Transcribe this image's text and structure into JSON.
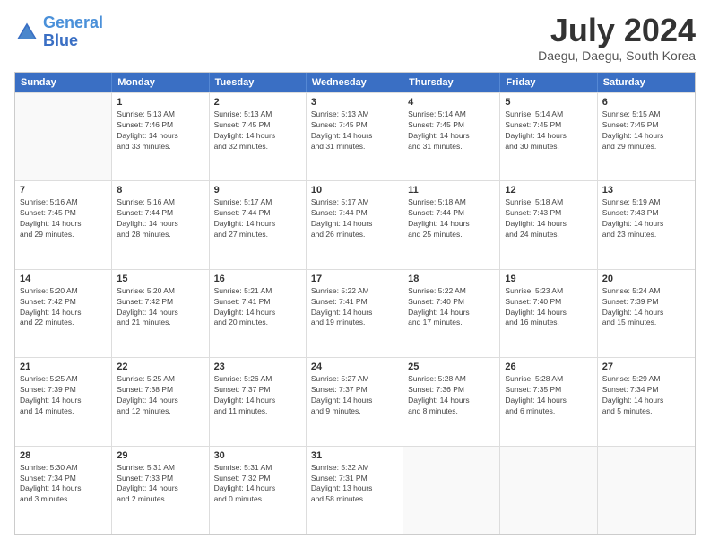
{
  "logo": {
    "line1": "General",
    "line2": "Blue"
  },
  "title": "July 2024",
  "subtitle": "Daegu, Daegu, South Korea",
  "headers": [
    "Sunday",
    "Monday",
    "Tuesday",
    "Wednesday",
    "Thursday",
    "Friday",
    "Saturday"
  ],
  "weeks": [
    [
      {
        "day": "",
        "info": ""
      },
      {
        "day": "1",
        "info": "Sunrise: 5:13 AM\nSunset: 7:46 PM\nDaylight: 14 hours\nand 33 minutes."
      },
      {
        "day": "2",
        "info": "Sunrise: 5:13 AM\nSunset: 7:45 PM\nDaylight: 14 hours\nand 32 minutes."
      },
      {
        "day": "3",
        "info": "Sunrise: 5:13 AM\nSunset: 7:45 PM\nDaylight: 14 hours\nand 31 minutes."
      },
      {
        "day": "4",
        "info": "Sunrise: 5:14 AM\nSunset: 7:45 PM\nDaylight: 14 hours\nand 31 minutes."
      },
      {
        "day": "5",
        "info": "Sunrise: 5:14 AM\nSunset: 7:45 PM\nDaylight: 14 hours\nand 30 minutes."
      },
      {
        "day": "6",
        "info": "Sunrise: 5:15 AM\nSunset: 7:45 PM\nDaylight: 14 hours\nand 29 minutes."
      }
    ],
    [
      {
        "day": "7",
        "info": "Sunrise: 5:16 AM\nSunset: 7:45 PM\nDaylight: 14 hours\nand 29 minutes."
      },
      {
        "day": "8",
        "info": "Sunrise: 5:16 AM\nSunset: 7:44 PM\nDaylight: 14 hours\nand 28 minutes."
      },
      {
        "day": "9",
        "info": "Sunrise: 5:17 AM\nSunset: 7:44 PM\nDaylight: 14 hours\nand 27 minutes."
      },
      {
        "day": "10",
        "info": "Sunrise: 5:17 AM\nSunset: 7:44 PM\nDaylight: 14 hours\nand 26 minutes."
      },
      {
        "day": "11",
        "info": "Sunrise: 5:18 AM\nSunset: 7:44 PM\nDaylight: 14 hours\nand 25 minutes."
      },
      {
        "day": "12",
        "info": "Sunrise: 5:18 AM\nSunset: 7:43 PM\nDaylight: 14 hours\nand 24 minutes."
      },
      {
        "day": "13",
        "info": "Sunrise: 5:19 AM\nSunset: 7:43 PM\nDaylight: 14 hours\nand 23 minutes."
      }
    ],
    [
      {
        "day": "14",
        "info": "Sunrise: 5:20 AM\nSunset: 7:42 PM\nDaylight: 14 hours\nand 22 minutes."
      },
      {
        "day": "15",
        "info": "Sunrise: 5:20 AM\nSunset: 7:42 PM\nDaylight: 14 hours\nand 21 minutes."
      },
      {
        "day": "16",
        "info": "Sunrise: 5:21 AM\nSunset: 7:41 PM\nDaylight: 14 hours\nand 20 minutes."
      },
      {
        "day": "17",
        "info": "Sunrise: 5:22 AM\nSunset: 7:41 PM\nDaylight: 14 hours\nand 19 minutes."
      },
      {
        "day": "18",
        "info": "Sunrise: 5:22 AM\nSunset: 7:40 PM\nDaylight: 14 hours\nand 17 minutes."
      },
      {
        "day": "19",
        "info": "Sunrise: 5:23 AM\nSunset: 7:40 PM\nDaylight: 14 hours\nand 16 minutes."
      },
      {
        "day": "20",
        "info": "Sunrise: 5:24 AM\nSunset: 7:39 PM\nDaylight: 14 hours\nand 15 minutes."
      }
    ],
    [
      {
        "day": "21",
        "info": "Sunrise: 5:25 AM\nSunset: 7:39 PM\nDaylight: 14 hours\nand 14 minutes."
      },
      {
        "day": "22",
        "info": "Sunrise: 5:25 AM\nSunset: 7:38 PM\nDaylight: 14 hours\nand 12 minutes."
      },
      {
        "day": "23",
        "info": "Sunrise: 5:26 AM\nSunset: 7:37 PM\nDaylight: 14 hours\nand 11 minutes."
      },
      {
        "day": "24",
        "info": "Sunrise: 5:27 AM\nSunset: 7:37 PM\nDaylight: 14 hours\nand 9 minutes."
      },
      {
        "day": "25",
        "info": "Sunrise: 5:28 AM\nSunset: 7:36 PM\nDaylight: 14 hours\nand 8 minutes."
      },
      {
        "day": "26",
        "info": "Sunrise: 5:28 AM\nSunset: 7:35 PM\nDaylight: 14 hours\nand 6 minutes."
      },
      {
        "day": "27",
        "info": "Sunrise: 5:29 AM\nSunset: 7:34 PM\nDaylight: 14 hours\nand 5 minutes."
      }
    ],
    [
      {
        "day": "28",
        "info": "Sunrise: 5:30 AM\nSunset: 7:34 PM\nDaylight: 14 hours\nand 3 minutes."
      },
      {
        "day": "29",
        "info": "Sunrise: 5:31 AM\nSunset: 7:33 PM\nDaylight: 14 hours\nand 2 minutes."
      },
      {
        "day": "30",
        "info": "Sunrise: 5:31 AM\nSunset: 7:32 PM\nDaylight: 14 hours\nand 0 minutes."
      },
      {
        "day": "31",
        "info": "Sunrise: 5:32 AM\nSunset: 7:31 PM\nDaylight: 13 hours\nand 58 minutes."
      },
      {
        "day": "",
        "info": ""
      },
      {
        "day": "",
        "info": ""
      },
      {
        "day": "",
        "info": ""
      }
    ]
  ]
}
